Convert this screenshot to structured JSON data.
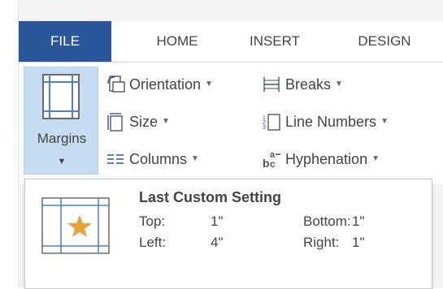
{
  "tabs": [
    {
      "label": "FILE"
    },
    {
      "label": "HOME"
    },
    {
      "label": "INSERT"
    },
    {
      "label": "DESIGN"
    }
  ],
  "page_setup": {
    "margins": {
      "label": "Margins",
      "icon": "margins-icon"
    },
    "orientation": {
      "label": "Orientation",
      "icon": "orientation-icon"
    },
    "size": {
      "label": "Size",
      "icon": "size-icon"
    },
    "columns": {
      "label": "Columns",
      "icon": "columns-icon"
    },
    "breaks": {
      "label": "Breaks",
      "icon": "breaks-icon"
    },
    "line_numbers": {
      "label": "Line Numbers",
      "icon": "line-numbers-icon"
    },
    "hyphenation": {
      "label": "Hyphenation",
      "icon": "hyphenation-icon"
    }
  },
  "margins_menu": {
    "items": [
      {
        "title": "Last Custom Setting",
        "icon": "custom-margins-star-icon",
        "top_label": "Top:",
        "top_value": "1\"",
        "bottom_label": "Bottom:",
        "bottom_value": "1\"",
        "left_label": "Left:",
        "left_value": "4\"",
        "right_label": "Right:",
        "right_value": "1\""
      }
    ]
  },
  "colors": {
    "file_tab": "#2b579a",
    "selected_button": "#c5dcf3",
    "star": "#e8a33a",
    "margin_guides": "#4f81bd"
  }
}
